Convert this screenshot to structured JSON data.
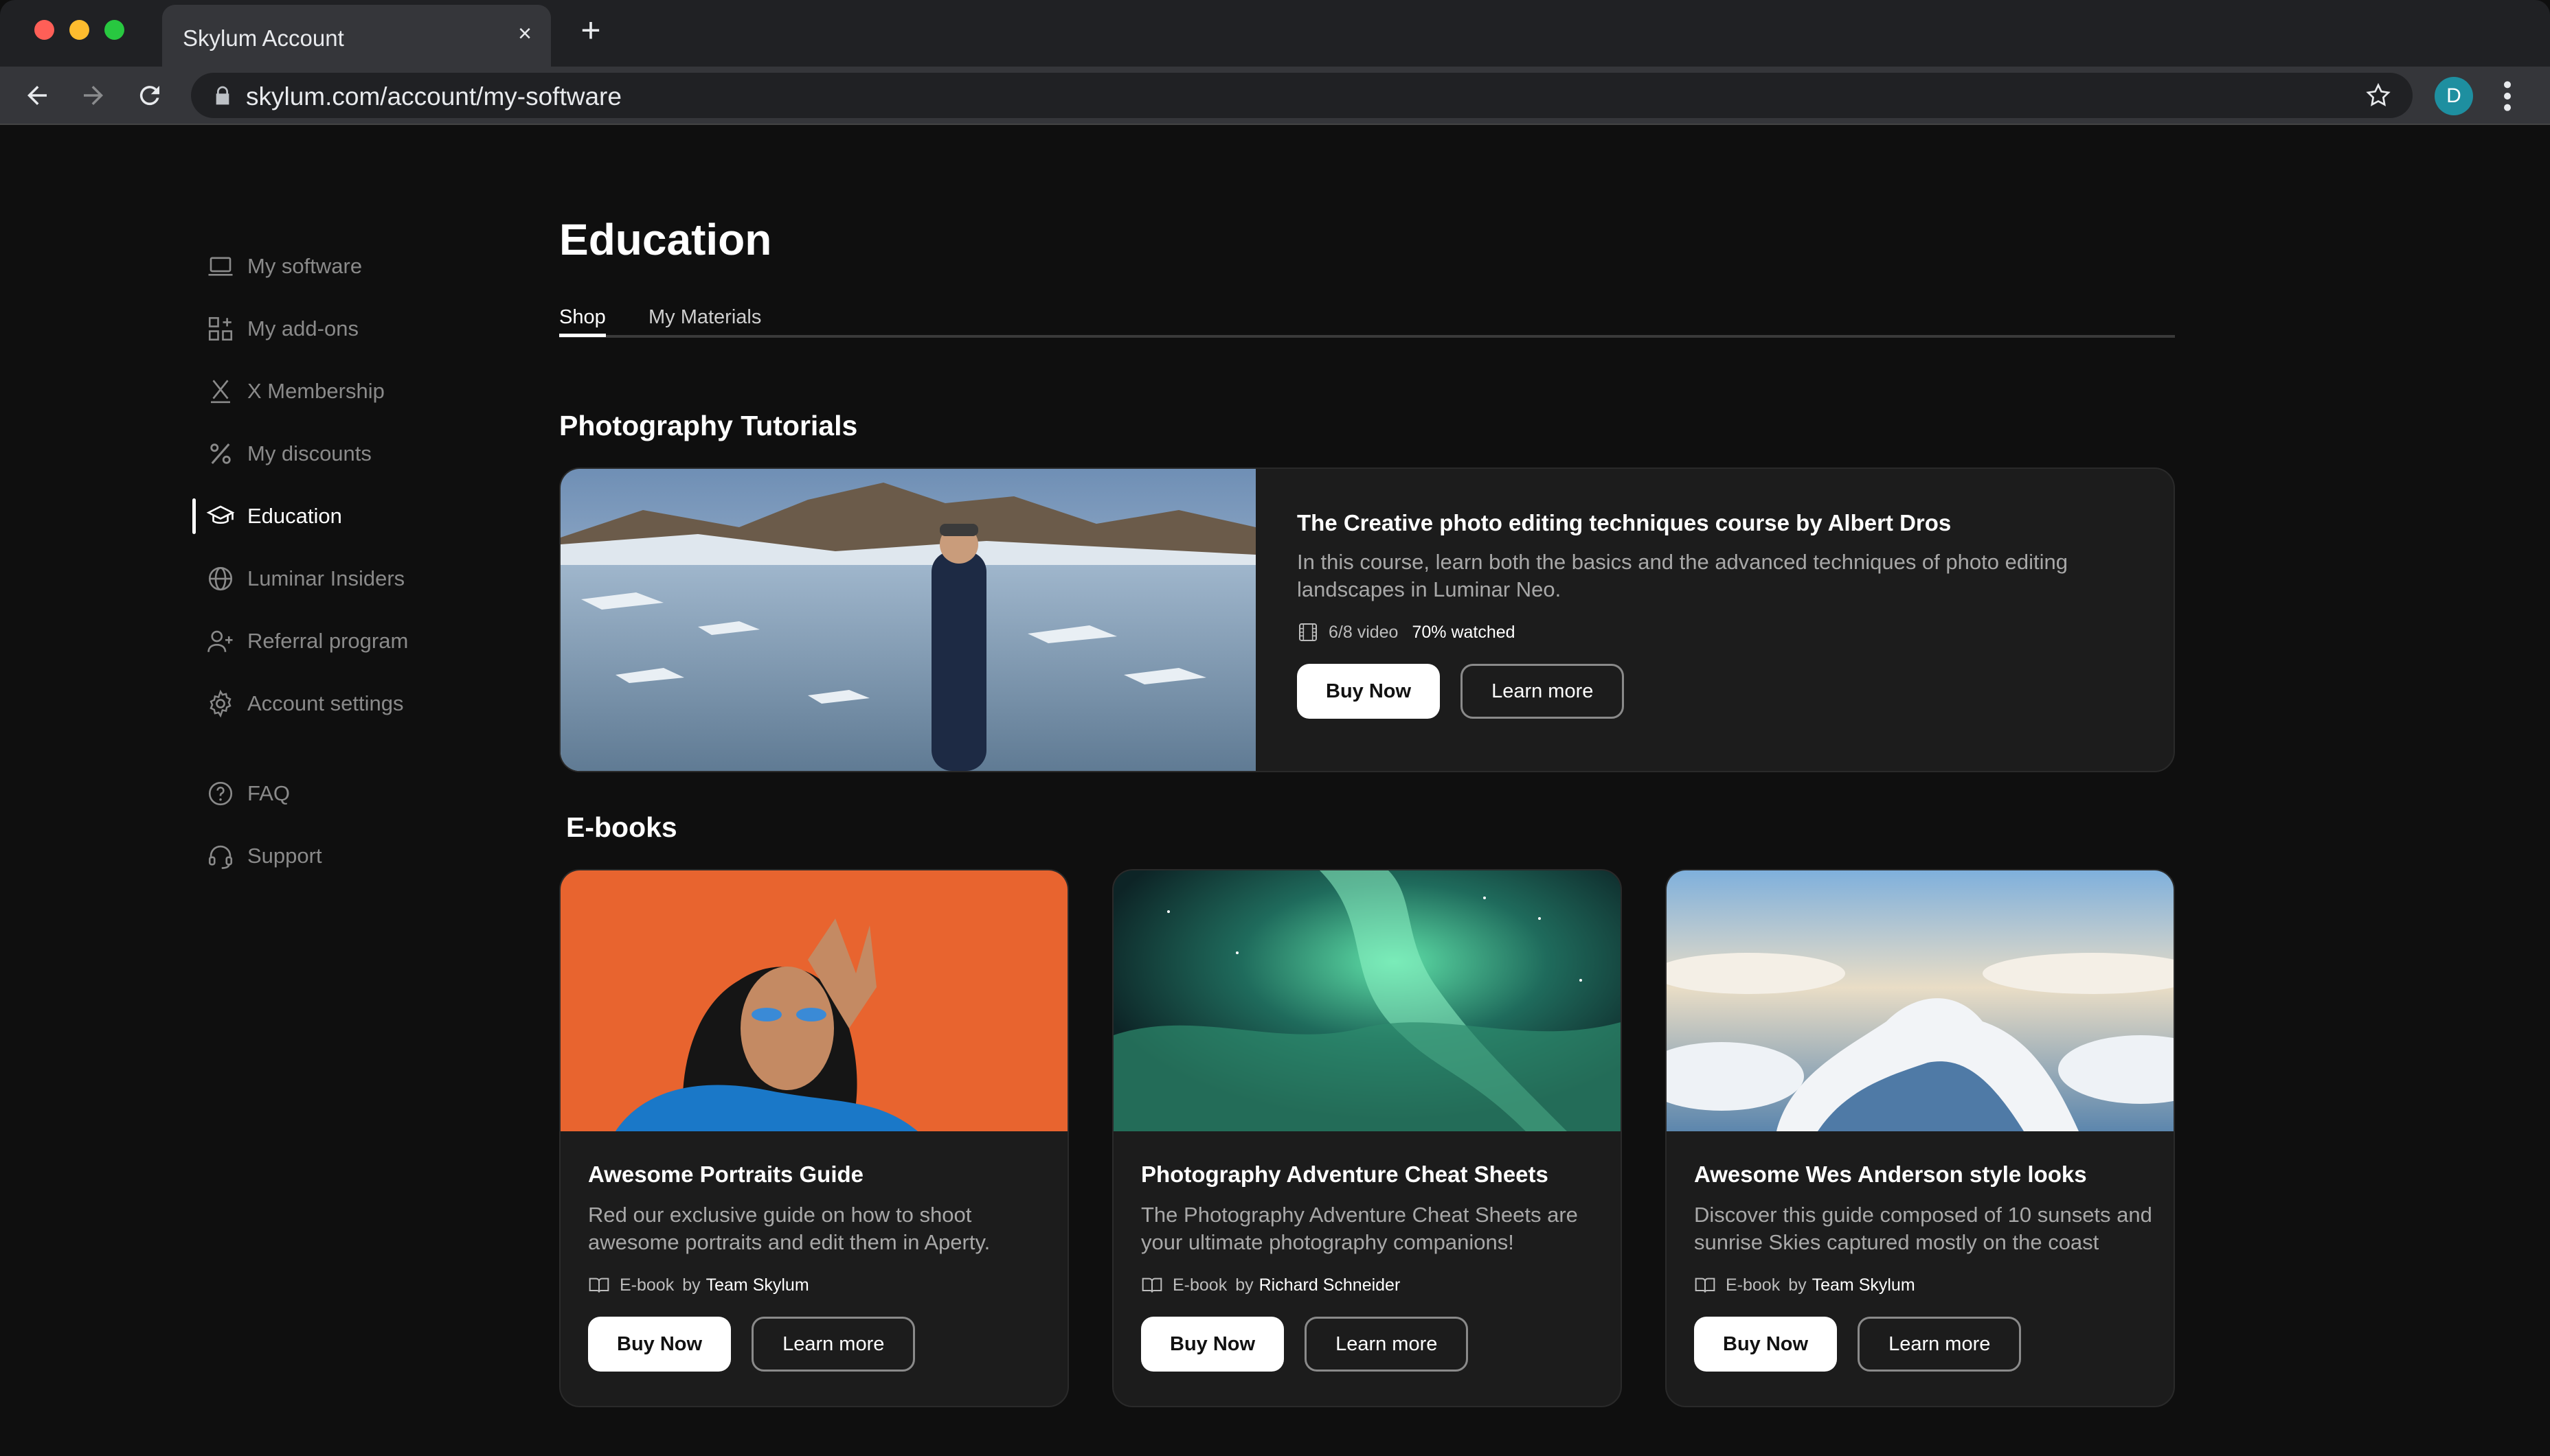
{
  "browser": {
    "tab_title": "Skylum Account",
    "tab_close": "×",
    "new_tab": "+",
    "url": "skylum.com/account/my-software",
    "profile_initial": "D"
  },
  "sidebar": {
    "items": [
      {
        "label": "My software",
        "icon": "laptop-icon"
      },
      {
        "label": "My add-ons",
        "icon": "grid-plus-icon"
      },
      {
        "label": "X Membership",
        "icon": "x-membership-icon"
      },
      {
        "label": "My discounts",
        "icon": "percent-icon"
      },
      {
        "label": "Education",
        "icon": "graduation-cap-icon",
        "active": true
      },
      {
        "label": "Luminar Insiders",
        "icon": "globe-icon"
      },
      {
        "label": "Referral program",
        "icon": "user-plus-icon"
      },
      {
        "label": "Account settings",
        "icon": "gear-icon"
      }
    ],
    "secondary": [
      {
        "label": "FAQ",
        "icon": "question-circle-icon"
      },
      {
        "label": "Support",
        "icon": "headset-icon"
      }
    ]
  },
  "main": {
    "title": "Education",
    "tabs": [
      "Shop",
      "My Materials"
    ],
    "tutorials_title": "Photography Tutorials",
    "course": {
      "title": "The Creative photo editing techniques course by Albert Dros",
      "description": "In this course, learn both the basics and the advanced techniques of photo editing landscapes in Luminar Neo.",
      "video_count": "6/8 video",
      "watched": "70% watched",
      "buy_label": "Buy Now",
      "learn_label": "Learn more"
    },
    "ebooks_title": "E-books",
    "ebooks": [
      {
        "title": "Awesome Portraits Guide",
        "description": "Red our exclusive guide on how to shoot awesome portraits and edit them in Aperty.",
        "type": "E-book",
        "by": "by",
        "author": "Team Skylum",
        "buy_label": "Buy Now",
        "learn_label": "Learn more"
      },
      {
        "title": "Photography Adventure Cheat Sheets",
        "description": "The Photography Adventure Cheat Sheets are your ultimate photography companions!",
        "type": "E-book",
        "by": "by",
        "author": "Richard Schneider",
        "buy_label": "Buy Now",
        "learn_label": "Learn more"
      },
      {
        "title": "Awesome Wes Anderson style looks",
        "description": "Discover this guide composed of 10 sunsets and sunrise Skies captured mostly on the coast",
        "type": "E-book",
        "by": "by",
        "author": "Team Skylum",
        "buy_label": "Buy Now",
        "learn_label": "Learn more"
      }
    ]
  },
  "colors": {
    "background": "#0f0f0f",
    "card": "#1c1c1c",
    "chrome": "#35363a",
    "profile": "#1e8fa0"
  }
}
